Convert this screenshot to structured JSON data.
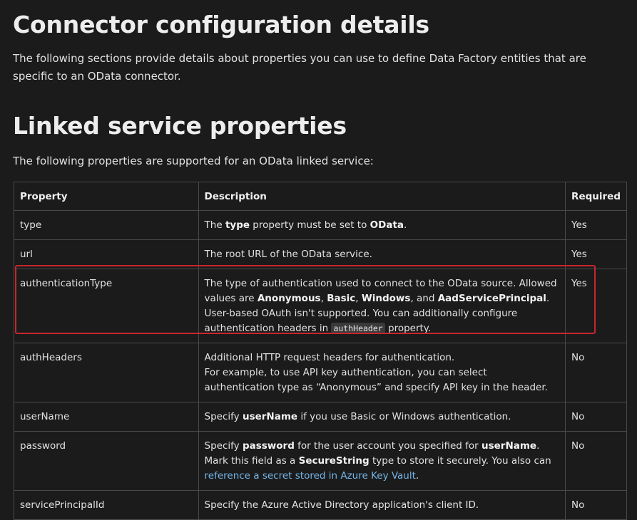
{
  "section1": {
    "title": "Connector configuration details",
    "intro": "The following sections provide details about properties you can use to define Data Factory entities that are specific to an OData connector."
  },
  "section2": {
    "title": "Linked service properties",
    "intro": "The following properties are supported for an OData linked service:"
  },
  "table": {
    "headers": [
      "Property",
      "Description",
      "Required"
    ],
    "rows": [
      {
        "property": "type",
        "d1": "The ",
        "b1": "type",
        "d2": " property must be set to ",
        "b2": "OData",
        "d3": ".",
        "required": "Yes"
      },
      {
        "property": "url",
        "desc": "The root URL of the OData service.",
        "required": "Yes"
      },
      {
        "property": "authenticationType",
        "d1": "The type of authentication used to connect to the OData source. Allowed values are ",
        "b1": "Anonymous",
        "s1": ", ",
        "b2": "Basic",
        "s2": ", ",
        "b3": "Windows",
        "s3": ", and ",
        "b4": "AadServicePrincipal",
        "d2": ". User-based OAuth isn't supported. You can additionally configure authentication headers in ",
        "code": "authHeader",
        "d3": " property.",
        "required": "Yes"
      },
      {
        "property": "authHeaders",
        "line1": "Additional HTTP request headers for authentication.",
        "line2": "For example, to use API key authentication, you can select authentication type as “Anonymous” and specify API key in the header.",
        "required": "No"
      },
      {
        "property": "userName",
        "d1": "Specify ",
        "b1": "userName",
        "d2": " if you use Basic or Windows authentication.",
        "required": "No"
      },
      {
        "property": "password",
        "d1": "Specify ",
        "b1": "password",
        "d2": " for the user account you specified for ",
        "b2": "userName",
        "d3": ". Mark this field as a ",
        "b3": "SecureString",
        "d4": " type to store it securely. You also can ",
        "link": "reference a secret stored in Azure Key Vault",
        "d5": ".",
        "required": "No"
      },
      {
        "property": "servicePrincipalId",
        "desc": "Specify the Azure Active Directory application's client ID.",
        "required": "No"
      }
    ]
  },
  "highlight_color": "#c8262c"
}
